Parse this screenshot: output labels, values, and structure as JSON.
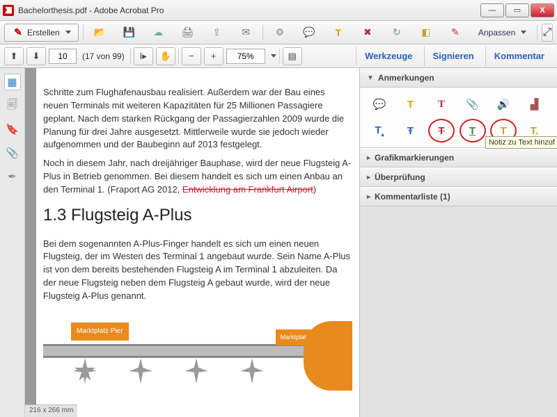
{
  "window": {
    "title": "Bachelorthesis.pdf - Adobe Acrobat Pro"
  },
  "toolbar": {
    "create": "Erstellen",
    "customize": "Anpassen"
  },
  "nav": {
    "page_value": "10",
    "page_count": "(17 von 99)",
    "zoom": "75%",
    "tools": "Werkzeuge",
    "sign": "Signieren",
    "comment": "Kommentar"
  },
  "doc": {
    "para1": "Schritte zum Flughafenausbau realisiert. Außerdem war der Bau eines neuen Terminals mit weiteren Kapazitäten für 25 Millionen Passagiere geplant. Nach dem starken Rückgang der Passagierzahlen 2009 wurde die Planung für drei Jahre ausgesetzt. Mittlerweile wurde sie jedoch wieder aufgenommen und der Baubeginn auf 2013 festgelegt.",
    "para2a": "Noch in diesem Jahr, nach dreijähriger Bauphase, wird der neue Flugsteig A-Plus in Betrieb genommen. Bei diesem handelt es sich um einen Anbau an den Terminal 1. (Fraport AG 2012, ",
    "para2strike": "Entwicklung am Frankfurt Airport",
    "para2b": ")",
    "heading": "1.3 Flugsteig A-Plus",
    "para3": "Bei dem sogenannten A-Plus-Finger handelt es sich um einen neuen Flugsteig, der im Westen des Terminal 1 angebaut wurde. Sein Name A-Plus ist von dem bereits bestehenden Flugsteig A im Terminal 1 abzuleiten. Da der neue Flugsteig neben dem Flugsteig A gebaut wurde, wird der neue Flugsteig A-Plus genannt.",
    "diagram_label1": "Marktplatz Pier",
    "diagram_label2": "Marktplatz Atrium",
    "status": "216 x 266 mm"
  },
  "rightpanel": {
    "annotations": "Anmerkungen",
    "graphics": "Grafikmarkierungen",
    "review": "Überprüfung",
    "comments": "Kommentarliste (1)",
    "tooltip": "Notiz zu Text hinzuf"
  }
}
